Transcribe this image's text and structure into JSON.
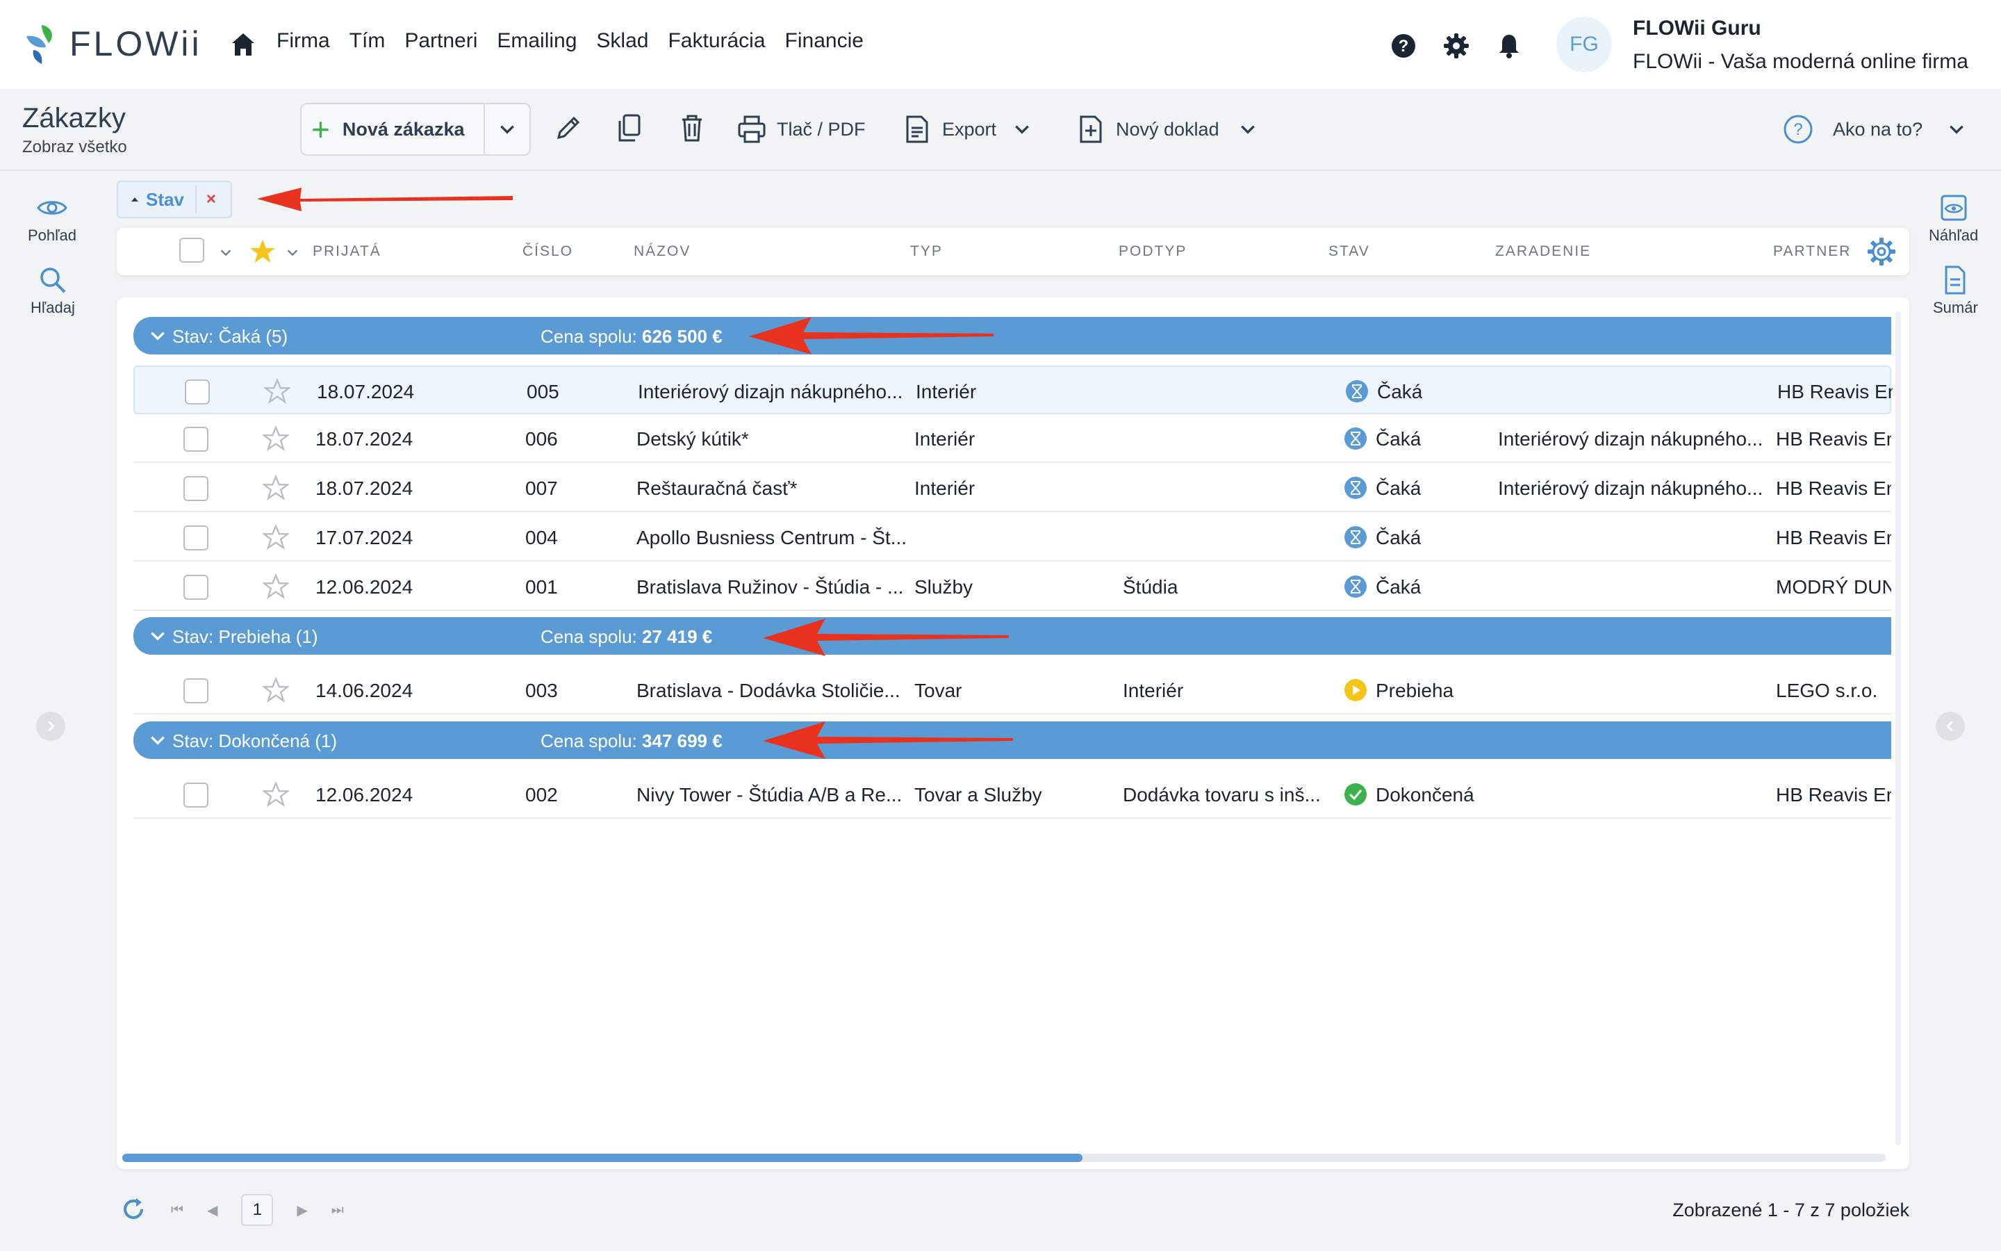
{
  "app": {
    "logo_text": "FLOWii"
  },
  "nav": {
    "items": [
      "Firma",
      "Tím",
      "Partneri",
      "Emailing",
      "Sklad",
      "Fakturácia",
      "Financie"
    ]
  },
  "user": {
    "initials": "FG",
    "name": "FLOWii Guru",
    "company": "FLOWii - Vaša moderná online firma"
  },
  "page": {
    "title": "Zákazky",
    "subtitle": "Zobraz všetko"
  },
  "toolbar": {
    "new_label": "Nová zákazka",
    "print_label": "Tlač / PDF",
    "export_label": "Export",
    "new_doc_label": "Nový doklad",
    "help_label": "Ako na to?"
  },
  "left_rail": {
    "view_label": "Pohľad",
    "search_label": "Hľadaj"
  },
  "right_rail": {
    "preview_label": "Náhľad",
    "summary_label": "Sumár"
  },
  "filter_chip": {
    "label": "Stav",
    "remove": "×"
  },
  "columns": [
    "PRIJATÁ",
    "ČÍSLO",
    "NÁZOV",
    "TYP",
    "PODTYP",
    "STAV",
    "ZARADENIE",
    "PARTNER"
  ],
  "groups": [
    {
      "title": "Stav: Čaká (5)",
      "price_label": "Cena spolu:",
      "price_value": "626 500 €",
      "rows": [
        {
          "date": "18.07.2024",
          "num": "005",
          "name": "Interiérový dizajn nákupného...",
          "typ": "Interiér",
          "podtyp": "",
          "stav": "Čaká",
          "zaradenie": "",
          "partner": "HB Reavis En"
        },
        {
          "date": "18.07.2024",
          "num": "006",
          "name": "Detský kútik*",
          "typ": "Interiér",
          "podtyp": "",
          "stav": "Čaká",
          "zaradenie": "Interiérový dizajn nákupného...",
          "partner": "HB Reavis En"
        },
        {
          "date": "18.07.2024",
          "num": "007",
          "name": "Reštauračná časť*",
          "typ": "Interiér",
          "podtyp": "",
          "stav": "Čaká",
          "zaradenie": "Interiérový dizajn nákupného...",
          "partner": "HB Reavis En"
        },
        {
          "date": "17.07.2024",
          "num": "004",
          "name": "Apollo Busniess Centrum - Št...",
          "typ": "",
          "podtyp": "",
          "stav": "Čaká",
          "zaradenie": "",
          "partner": "HB Reavis En"
        },
        {
          "date": "12.06.2024",
          "num": "001",
          "name": "Bratislava Ružinov - Štúdia - ...",
          "typ": "Služby",
          "podtyp": "Štúdia",
          "stav": "Čaká",
          "zaradenie": "",
          "partner": "MODRÝ DUN"
        }
      ]
    },
    {
      "title": "Stav: Prebieha (1)",
      "price_label": "Cena spolu:",
      "price_value": "27 419 €",
      "rows": [
        {
          "date": "14.06.2024",
          "num": "003",
          "name": "Bratislava - Dodávka Stoličie...",
          "typ": "Tovar",
          "podtyp": "Interiér",
          "stav": "Prebieha",
          "zaradenie": "",
          "partner": "LEGO s.r.o."
        }
      ]
    },
    {
      "title": "Stav: Dokončená (1)",
      "price_label": "Cena spolu:",
      "price_value": "347 699 €",
      "rows": [
        {
          "date": "12.06.2024",
          "num": "002",
          "name": "Nivy Tower - Štúdia A/B a Re...",
          "typ": "Tovar a Služby",
          "podtyp": "Dodávka tovaru s inš...",
          "stav": "Dokončená",
          "zaradenie": "",
          "partner": "HB Reavis En"
        }
      ]
    }
  ],
  "pagination": {
    "current_page": "1",
    "info": "Zobrazené 1 - 7 z 7 položiek"
  },
  "colors": {
    "accent": "#5b9bd5",
    "waiting": "#5b9bd5",
    "running": "#f5c518",
    "done": "#3cb34a",
    "annotation": "#e8321e"
  }
}
